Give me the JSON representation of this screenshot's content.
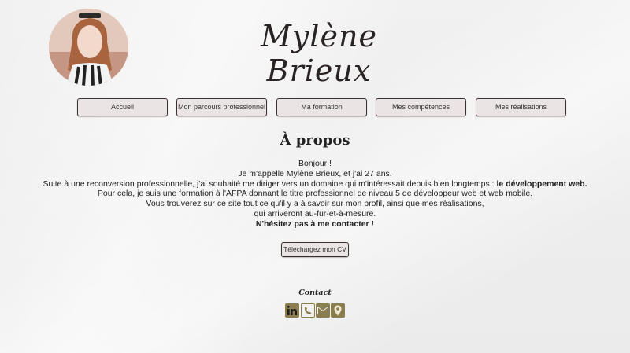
{
  "header": {
    "title": "Mylène Brieux"
  },
  "nav": {
    "items": [
      {
        "label": "Accueil"
      },
      {
        "label": "Mon parcours professionnel"
      },
      {
        "label": "Ma formation"
      },
      {
        "label": "Mes compétences"
      },
      {
        "label": "Mes réalisations"
      }
    ]
  },
  "about": {
    "heading": "À propos",
    "line1": "Bonjour !",
    "line2": "Je m'appelle Mylène Brieux, et j'ai 27 ans.",
    "line3_prefix": "Suite à une reconversion professionnelle, j'ai souhaité me diriger vers un domaine qui m'intéressait depuis bien longtemps : ",
    "line3_bold": "le développement web.",
    "line4": "Pour cela, je suis une formation à l'AFPA donnant le titre professionnel de niveau 5 de développeur web et web mobile.",
    "line5": "Vous trouverez sur ce site tout ce qu'il y a à savoir sur mon profil, ainsi que mes réalisations,",
    "line6": "qui arriveront au-fur-et-à-mesure.",
    "line7_bold": "N'hésitez pas à me contacter !",
    "cv_button": "Téléchargez mon CV"
  },
  "contact": {
    "title": "Contact",
    "icons": [
      "linkedin-icon",
      "phone-icon",
      "mail-icon",
      "location-icon"
    ],
    "accent": "#8a7d4e"
  }
}
